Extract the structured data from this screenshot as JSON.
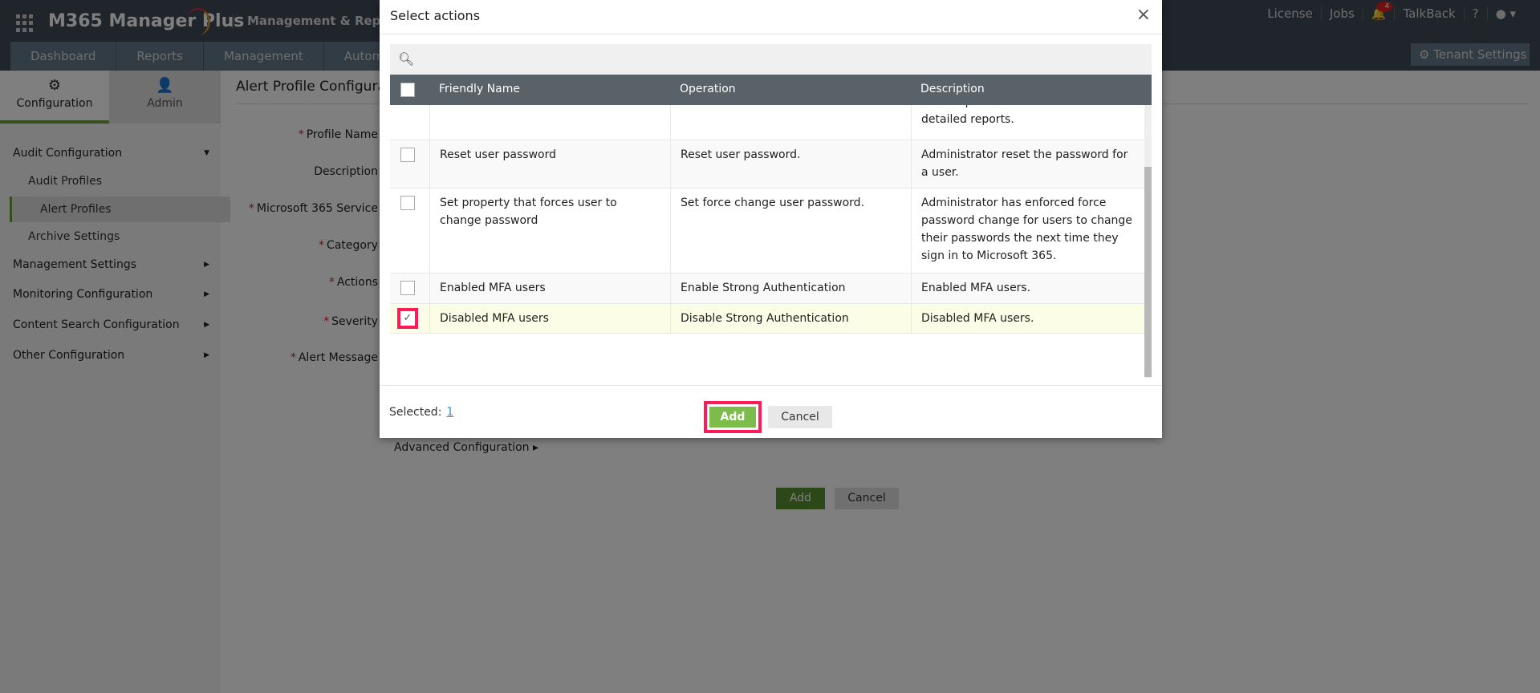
{
  "header": {
    "app_name": "M365 Manager Plus",
    "product": "Management & Reporting",
    "tabs": [
      "Dashboard",
      "Reports",
      "Management",
      "Automation"
    ],
    "links": {
      "license": "License",
      "jobs": "Jobs",
      "notifications": "4",
      "talkback": "TalkBack",
      "help": "?"
    },
    "tenant_settings": "Tenant Settings"
  },
  "sidebar": {
    "tabs": [
      "Configuration",
      "Admin"
    ],
    "items": [
      {
        "label": "Audit Configuration",
        "arrow": "▼"
      },
      {
        "label": "Audit Profiles"
      },
      {
        "label": "Alert Profiles"
      },
      {
        "label": "Archive Settings"
      },
      {
        "label": "Management Settings",
        "arrow": "▶"
      },
      {
        "label": "Monitoring Configuration",
        "arrow": "▶"
      },
      {
        "label": "Content Search Configuration",
        "arrow": "▶"
      },
      {
        "label": "Other Configuration",
        "arrow": "▶"
      }
    ]
  },
  "main": {
    "title": "Alert Profile Configuration",
    "labels": [
      "Profile Name",
      "Description",
      "Microsoft 365 Service",
      "Category",
      "Actions",
      "Severity",
      "Alert Message"
    ],
    "advanced": "Advanced Configuration ▸",
    "add": "Add",
    "cancel": "Cancel"
  },
  "modal": {
    "title": "Select actions",
    "close": "×",
    "columns": [
      "Friendly Name",
      "Operation",
      "Description"
    ],
    "rows": [
      {
        "name": "",
        "operation": "",
        "description": "service password reset activities with detailed reports.",
        "checked": false
      },
      {
        "name": "Reset user password",
        "operation": "Reset user password.",
        "description": "Administrator reset the password for a user.",
        "checked": false
      },
      {
        "name": "Set property that forces user to change password",
        "operation": "Set force change user password.",
        "description": "Administrator has enforced force password change for users to change their passwords the next time they sign in to Microsoft 365.",
        "checked": false
      },
      {
        "name": "Enabled MFA users",
        "operation": "Enable Strong Authentication",
        "description": "Enabled MFA users.",
        "checked": false
      },
      {
        "name": "Disabled MFA users",
        "operation": "Disable Strong Authentication",
        "description": "Disabled MFA users.",
        "checked": true
      }
    ],
    "selected_label": "Selected:",
    "selected_count": "1",
    "add": "Add",
    "cancel": "Cancel"
  },
  "colors": {
    "accent": "#7cbc4a",
    "highlight": "#ff1a5a"
  }
}
